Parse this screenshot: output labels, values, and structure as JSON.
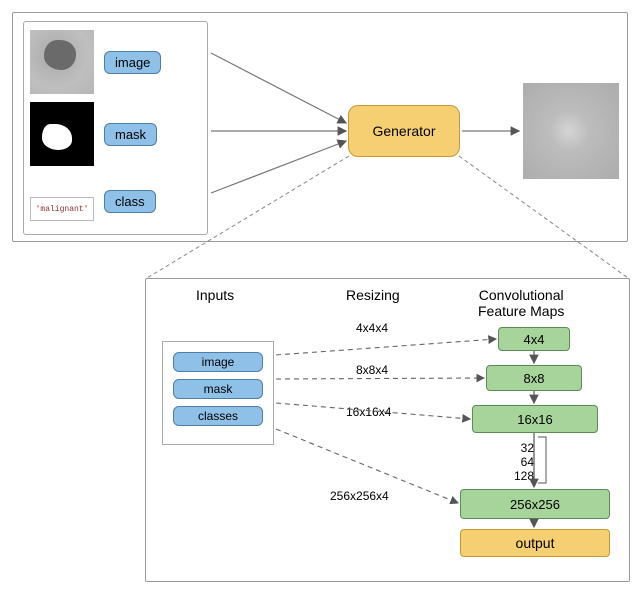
{
  "top": {
    "input_labels": {
      "image": "image",
      "mask": "mask",
      "class": "class"
    },
    "class_sample": "'malignant'",
    "generator_label": "Generator"
  },
  "bottom": {
    "headers": {
      "inputs": "Inputs",
      "resizing": "Resizing",
      "convmaps": "Convolutional\nFeature Maps"
    },
    "mini_inputs": {
      "image": "image",
      "mask": "mask",
      "classes": "classes"
    },
    "resize_labels": {
      "r1": "4x4x4",
      "r2": "8x8x4",
      "r3": "16x16x4",
      "r4": "256x256x4"
    },
    "featuremaps": {
      "f1": "4x4",
      "f2": "8x8",
      "f3": "16x16",
      "f4": "256x256"
    },
    "hidden_sizes": {
      "h1": "32",
      "h2": "64",
      "h3": "128"
    },
    "output_label": "output"
  }
}
